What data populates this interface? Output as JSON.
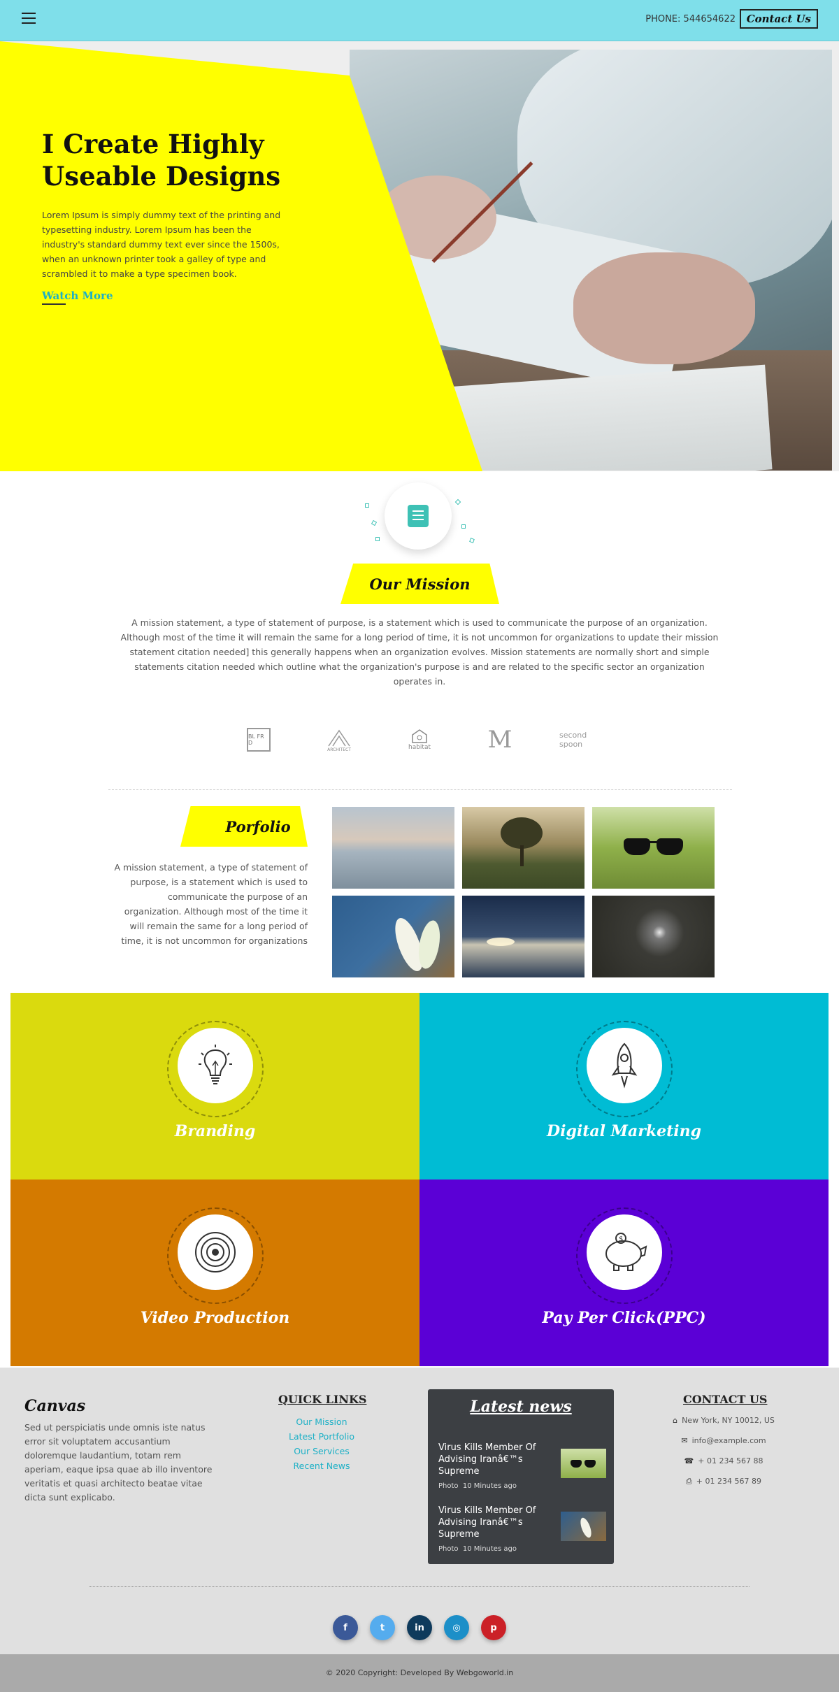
{
  "header": {
    "phone_label": "PHONE:",
    "phone_number": "544654622",
    "contact_button": "Contact Us",
    "bg_color": "#7fdfea"
  },
  "hero": {
    "title": "I Create Highly Useable Designs",
    "text": "Lorem Ipsum is simply dummy text of the printing and typesetting industry. Lorem Ipsum has been the industry's standard dummy text ever since the 1500s, when an unknown printer took a galley of type and scrambled it to make a type specimen book.",
    "link": "Watch More",
    "accent_color": "#ffff00"
  },
  "mission": {
    "title": "Our Mission",
    "text": "A mission statement, a type of statement of purpose, is a statement which is used to communicate the purpose of an organization. Although most of the time it will remain the same for a long period of time, it is not uncommon for organizations to update their mission statement citation needed] this generally happens when an organization evolves. Mission statements are normally short and simple statements citation needed which outline what the organization's purpose is and are related to the specific sector an organization operates in."
  },
  "logos": [
    {
      "name": "BLRD",
      "text": "BL FR D"
    },
    {
      "name": "mountain",
      "text": "ARCHITECT"
    },
    {
      "name": "habitat",
      "text": "habitat"
    },
    {
      "name": "MV",
      "text": "M"
    },
    {
      "name": "second-spoon",
      "text": "second spoon"
    }
  ],
  "portfolio": {
    "title": "Porfolio",
    "text": "A mission statement, a type of statement of purpose, is a statement which is used to communicate the purpose of an organization. Although most of the time it will remain the same for a long period of time, it is not uncommon for organizations"
  },
  "services": [
    {
      "title": "Branding",
      "color": "#dada0e",
      "icon": "lightbulb-icon"
    },
    {
      "title": "Digital Marketing",
      "color": "#00bcd4",
      "icon": "rocket-icon"
    },
    {
      "title": "Video Production",
      "color": "#d47a00",
      "icon": "video-reel-icon"
    },
    {
      "title": "Pay Per Click(PPC)",
      "color": "#5b00d6",
      "icon": "piggy-bank-icon"
    }
  ],
  "footer": {
    "about_title": "Canvas",
    "about_text": "Sed ut perspiciatis unde omnis iste natus error sit voluptatem accusantium doloremque laudantium, totam rem aperiam, eaque ipsa quae ab illo inventore veritatis et quasi architecto beatae vitae dicta sunt explicabo.",
    "quick_links_title": "QUICK LINKS",
    "quick_links": [
      "Our Mission",
      "Latest Portfolio",
      "Our Services",
      "Recent News"
    ],
    "news_title": "Latest news",
    "news": [
      {
        "headline": "Virus Kills Member Of Advising Iranâ€™s Supreme",
        "category": "Photo",
        "time": "10 Minutes ago"
      },
      {
        "headline": "Virus Kills Member Of Advising Iranâ€™s Supreme",
        "category": "Photo",
        "time": "10 Minutes ago"
      }
    ],
    "contact_title": "CONTACT US",
    "contact": [
      {
        "icon": "home-icon",
        "text": "New York, NY 10012, US"
      },
      {
        "icon": "envelope-icon",
        "text": "info@example.com"
      },
      {
        "icon": "phone-icon",
        "text": "+ 01 234 567 88"
      },
      {
        "icon": "printer-icon",
        "text": "+ 01 234 567 89"
      }
    ],
    "social": [
      {
        "name": "facebook",
        "glyph": "f",
        "color": "#3b5998"
      },
      {
        "name": "twitter",
        "glyph": "t",
        "color": "#55acee"
      },
      {
        "name": "linkedin",
        "glyph": "in",
        "color": "#0e3a5c"
      },
      {
        "name": "instagram",
        "glyph": "◎",
        "color": "#1c8fc8"
      },
      {
        "name": "pinterest",
        "glyph": "p",
        "color": "#cb2027"
      }
    ],
    "copyright": "© 2020 Copyright: Developed By Webgoworld.in"
  }
}
